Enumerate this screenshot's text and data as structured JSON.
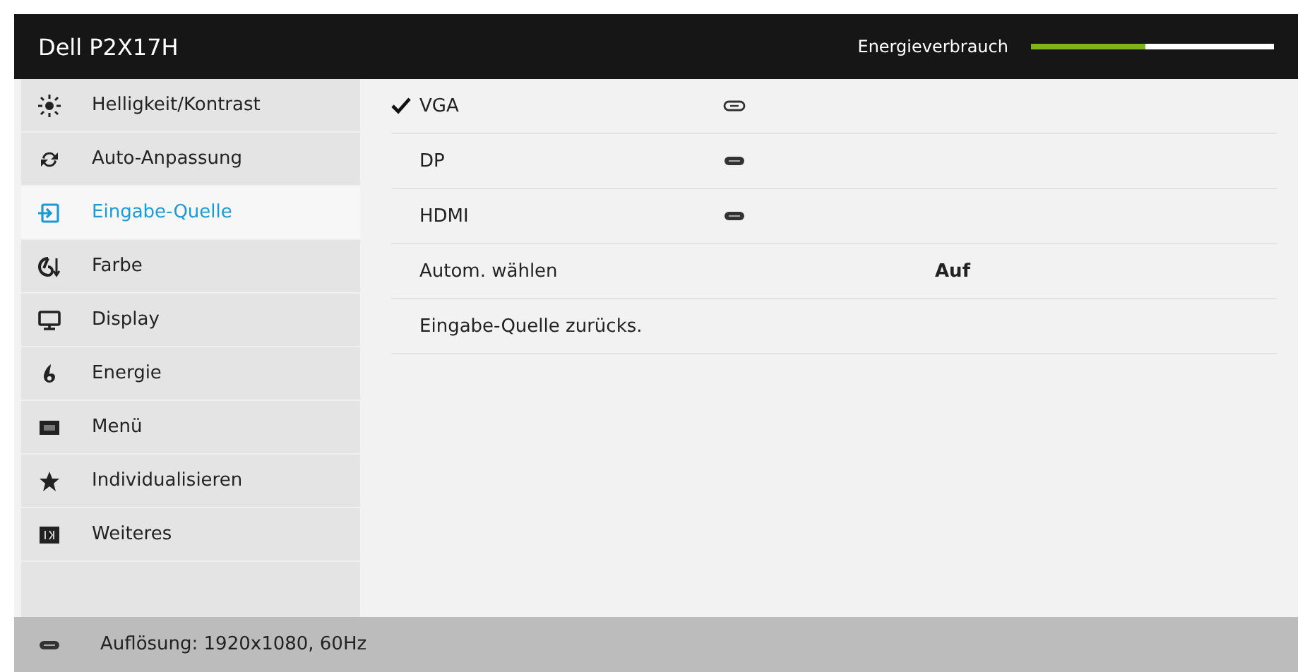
{
  "header": {
    "title": "Dell P2X17H",
    "meter_label": "Energieverbrauch",
    "meter": {
      "level": 0.47
    }
  },
  "sidebar": {
    "items": [
      {
        "label": "Helligkeit/Kontrast",
        "selected": false
      },
      {
        "label": "Auto-Anpassung",
        "selected": false
      },
      {
        "label": "Eingabe-Quelle",
        "selected": true
      },
      {
        "label": "Farbe",
        "selected": false
      },
      {
        "label": "Display",
        "selected": false
      },
      {
        "label": "Energie",
        "selected": false
      },
      {
        "label": "Menü",
        "selected": false
      },
      {
        "label": "Individualisieren",
        "selected": false
      },
      {
        "label": "Weiteres",
        "selected": false
      }
    ]
  },
  "options": [
    {
      "kind": "input",
      "label": "VGA",
      "checked": true,
      "connected": false
    },
    {
      "kind": "input",
      "label": "DP",
      "checked": false,
      "connected": true
    },
    {
      "kind": "input",
      "label": "HDMI",
      "checked": false,
      "connected": true
    },
    {
      "kind": "setting",
      "label": "Autom. wählen",
      "value": "Auf"
    },
    {
      "kind": "action",
      "label": "Eingabe-Quelle zurücks."
    }
  ],
  "status_bar": {
    "text": "Auflösung: 1920x1080, 60Hz"
  }
}
